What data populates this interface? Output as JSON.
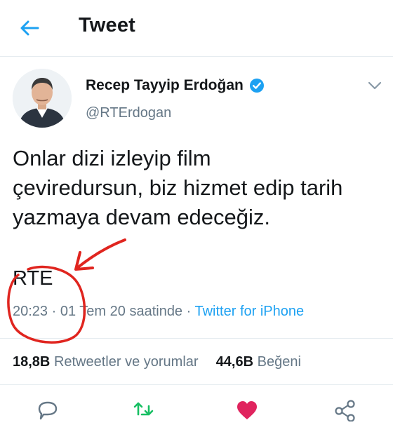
{
  "header": {
    "title": "Tweet",
    "back_icon": "back-arrow-icon"
  },
  "tweet": {
    "author_name": "Recep Tayyip Erdoğan",
    "handle": "@RTErdogan",
    "verified_icon": "verified-badge-icon",
    "text": "Onlar dizi izleyip film\nçeviredursun, biz hizmet edip tarih\nyazmaya devam edeceğiz.",
    "signature": "RTE",
    "time": "20:23",
    "separator": "·",
    "date": "01 Tem 20 saatinde",
    "source": "Twitter for iPhone",
    "retweets_count": "18,8B",
    "retweets_label": "Retweetler ve yorumlar",
    "likes_count": "44,6B",
    "likes_label": "Beğeni"
  },
  "actions": [
    "reply-icon",
    "retweet-icon",
    "like-icon",
    "share-icon"
  ],
  "colors": {
    "accent": "#1da1f2",
    "retweet": "#17bf63",
    "like": "#e0245e",
    "secondary_text": "#657786",
    "annotation": "#e0251f"
  }
}
